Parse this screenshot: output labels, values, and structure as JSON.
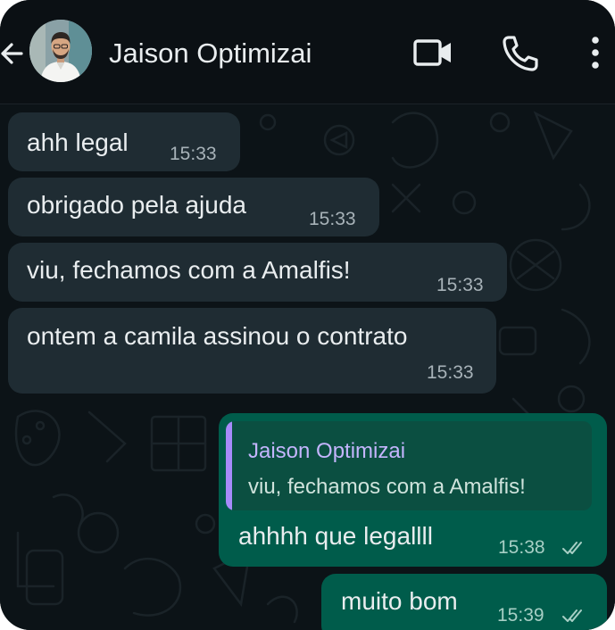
{
  "header": {
    "contact_name": "Jaison Optimizai",
    "back_icon": "arrow-left-icon",
    "video_icon": "video-camera-icon",
    "call_icon": "phone-icon",
    "menu_icon": "more-vertical-icon"
  },
  "messages": [
    {
      "direction": "incoming",
      "text": "ahh legal",
      "time": "15:33"
    },
    {
      "direction": "incoming",
      "text": "obrigado pela ajuda",
      "time": "15:33"
    },
    {
      "direction": "incoming",
      "text": "viu, fechamos com a Amalfis!",
      "time": "15:33"
    },
    {
      "direction": "incoming",
      "text": "ontem a camila assinou o contrato",
      "time": "15:33"
    },
    {
      "direction": "outgoing",
      "reply_to": {
        "name": "Jaison Optimizai",
        "text": "viu, fechamos com a Amalfis!"
      },
      "text": "ahhhh que legallll",
      "time": "15:38",
      "status": "read"
    },
    {
      "direction": "outgoing",
      "text": "muito bom",
      "time": "15:39",
      "status": "read"
    }
  ],
  "colors": {
    "background": "#0c1317",
    "incoming_bubble": "#1f2c33",
    "outgoing_bubble": "#005c4b",
    "quote_accent": "#a78bfa",
    "text": "#e9edef"
  }
}
